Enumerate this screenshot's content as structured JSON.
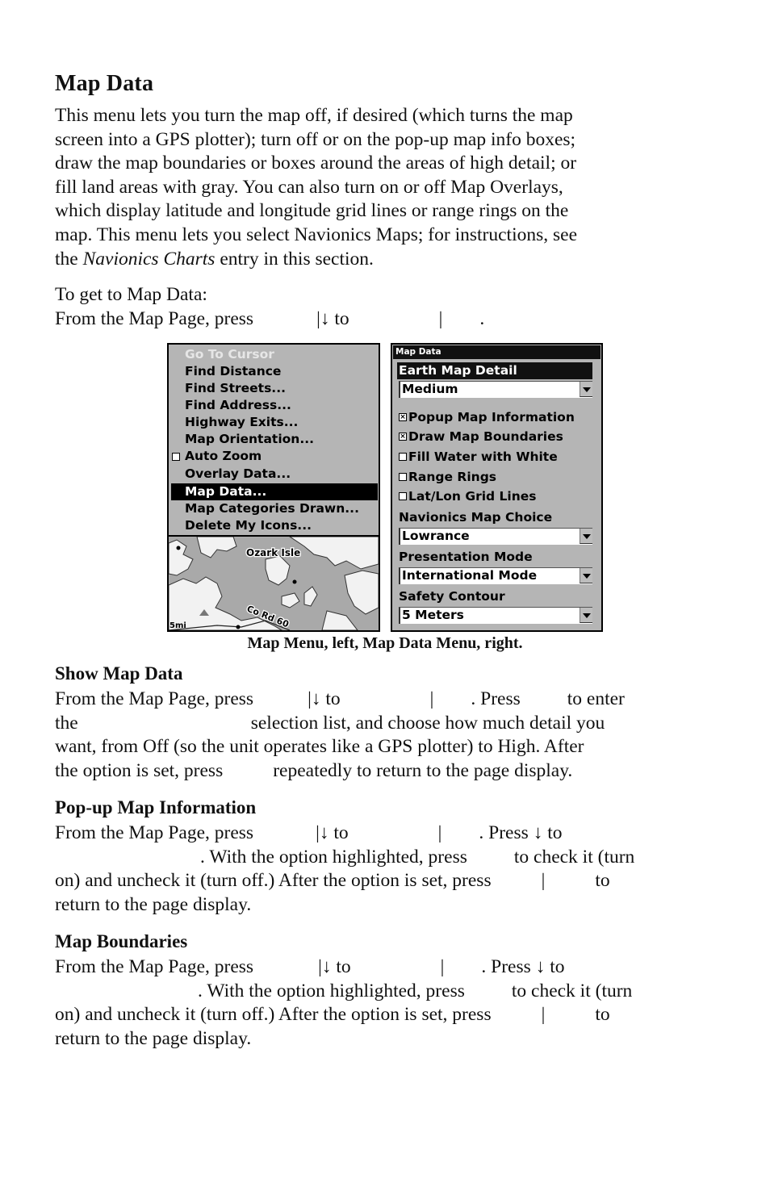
{
  "section": {
    "title": "Map Data",
    "intro_lines": [
      "This menu lets you turn the map off, if desired (which turns the map",
      "screen into a GPS plotter); turn off or on the pop-up map info boxes;",
      "draw the map boundaries or boxes around the areas of high detail; or",
      "fill land areas with gray. You can also turn on or off Map Overlays,",
      "which display latitude and longitude grid lines or range rings on the",
      "map. This menu lets you select Navionics Maps; for instructions, see"
    ],
    "intro_last_prefix": "the ",
    "intro_last_italic": "Navionics Charts",
    "intro_last_suffix": " entry in this section.",
    "howto_heading": "To get to Map Data:",
    "howto_line": {
      "a": "From the Map Page, press",
      "b": "|↓ to",
      "c": "|",
      "d": "."
    }
  },
  "left_screen": {
    "menu_items": [
      {
        "label": "Go To Cursor",
        "state": "disabled"
      },
      {
        "label": "Find Distance",
        "state": "normal"
      },
      {
        "label": "Find Streets...",
        "state": "normal"
      },
      {
        "label": "Find Address...",
        "state": "normal"
      },
      {
        "label": "Highway Exits...",
        "state": "normal"
      },
      {
        "label": "Map Orientation...",
        "state": "normal"
      },
      {
        "label": "Auto Zoom",
        "state": "checkbox-unchecked"
      },
      {
        "label": "Overlay Data...",
        "state": "normal"
      },
      {
        "label": "Map Data...",
        "state": "selected"
      },
      {
        "label": "Map Categories Drawn...",
        "state": "normal"
      },
      {
        "label": "Delete My Icons...",
        "state": "normal"
      }
    ],
    "map": {
      "place_label": "Ozark Isle",
      "road_label": "Co Rd 60",
      "scale_label": "5mi"
    }
  },
  "right_screen": {
    "title": "Map Data",
    "earth_map_detail": {
      "label": "Earth Map Detail",
      "value": "Medium"
    },
    "checkboxes": [
      {
        "label": "Popup Map Information",
        "checked": true
      },
      {
        "label": "Draw Map Boundaries",
        "checked": true
      },
      {
        "label": "Fill Water with White",
        "checked": false
      },
      {
        "label": "Range Rings",
        "checked": false
      },
      {
        "label": "Lat/Lon Grid Lines",
        "checked": false
      }
    ],
    "navionics_map_choice": {
      "label": "Navionics Map Choice",
      "value": "Lowrance"
    },
    "presentation_mode": {
      "label": "Presentation Mode",
      "value": "International Mode"
    },
    "safety_contour": {
      "label": "Safety Contour",
      "value": "5 Meters"
    }
  },
  "caption": "Map Menu, left, Map Data Menu, right.",
  "show_map_data": {
    "heading": "Show Map Data",
    "line1": [
      "From the Map Page, press",
      "|↓ to",
      "|",
      ". Press",
      "to enter"
    ],
    "line2": [
      "the",
      "selection list, and choose how much detail you"
    ],
    "line3": "want, from Off (so the unit operates like a GPS plotter) to High. After",
    "line4": [
      "the option is set, press",
      "repeatedly to return to the page display."
    ]
  },
  "popup_map_info": {
    "heading": "Pop-up Map Information",
    "line1": [
      "From the Map Page, press",
      "|↓ to",
      "|",
      ". Press ↓ to"
    ],
    "line2": [
      ". With the option highlighted, press",
      "to check it (turn"
    ],
    "line3": [
      "on) and uncheck it (turn off.) After the option is set, press",
      "|",
      "to"
    ],
    "line4": "return to the page display."
  },
  "map_boundaries": {
    "heading": "Map Boundaries",
    "line1": [
      "From the Map Page, press",
      "|↓ to",
      "|",
      ". Press ↓ to"
    ],
    "line2": [
      ". With the option highlighted, press",
      "to check it (turn"
    ],
    "line3": [
      "on) and uncheck it (turn off.) After the option is set, press",
      "|",
      "to"
    ],
    "line4": "return to the page display."
  }
}
